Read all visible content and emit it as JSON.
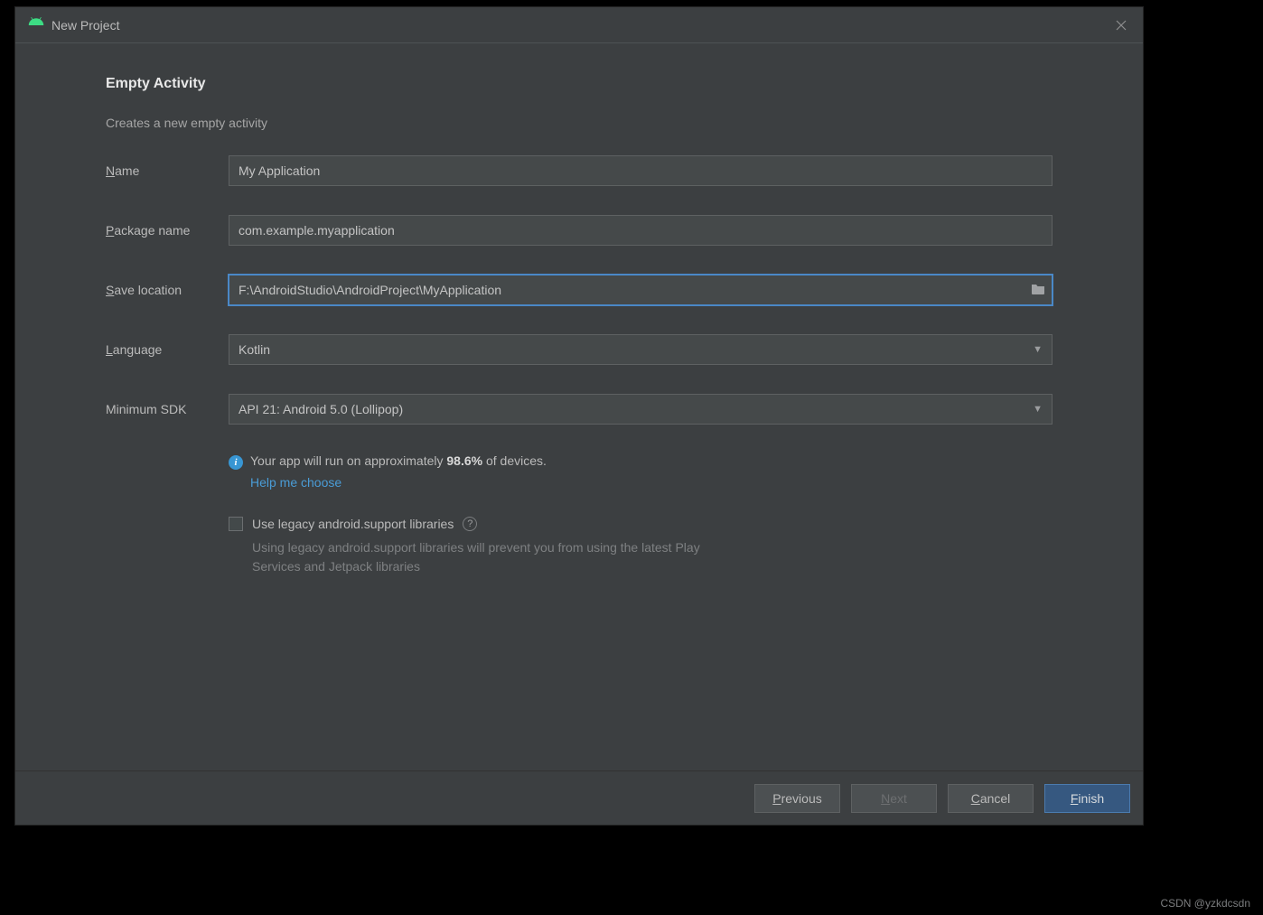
{
  "dialog": {
    "title": "New Project"
  },
  "heading": "Empty Activity",
  "subheading": "Creates a new empty activity",
  "form": {
    "name": {
      "label_u": "N",
      "label_rest": "ame",
      "value": "My Application"
    },
    "package": {
      "label_u": "P",
      "label_rest": "ackage name",
      "value": "com.example.myapplication"
    },
    "save_location": {
      "label_u": "S",
      "label_rest": "ave location",
      "value": "F:\\AndroidStudio\\AndroidProject\\MyApplication"
    },
    "language": {
      "label_u": "L",
      "label_rest": "anguage",
      "value": "Kotlin"
    },
    "min_sdk": {
      "label": "Minimum SDK",
      "value": "API 21: Android 5.0 (Lollipop)"
    }
  },
  "info": {
    "prefix": "Your app will run on approximately ",
    "pct": "98.6%",
    "suffix": " of devices.",
    "help_link": "Help me choose"
  },
  "legacy": {
    "label": "Use legacy android.support libraries",
    "hint": "Using legacy android.support libraries will prevent you from using the latest Play Services and Jetpack libraries"
  },
  "buttons": {
    "previous_u": "P",
    "previous_rest": "revious",
    "next_u": "N",
    "next_rest": "ext",
    "cancel_u": "C",
    "cancel_rest": "ancel",
    "finish_u": "F",
    "finish_rest": "inish"
  },
  "watermark": "CSDN @yzkdcsdn"
}
